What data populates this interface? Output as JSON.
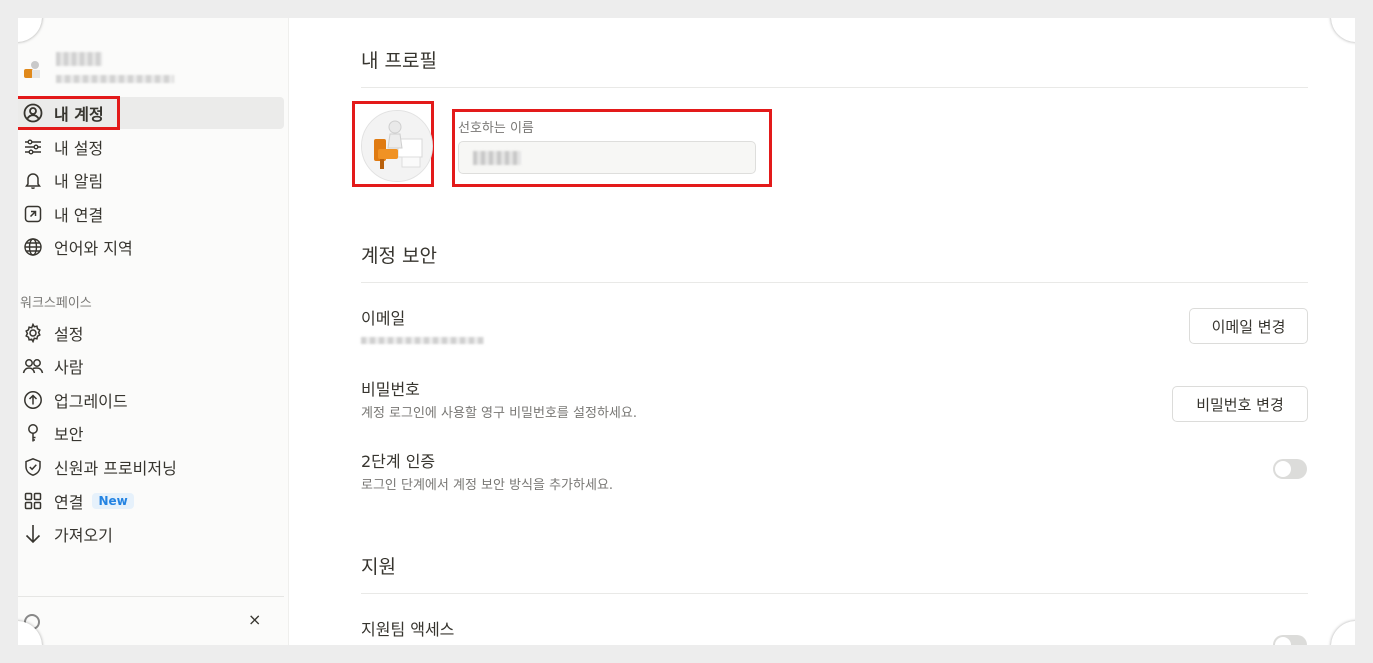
{
  "sidebar": {
    "account_items": [
      {
        "label": "내 계정",
        "icon": "user-circle-icon",
        "active": true
      },
      {
        "label": "내 설정",
        "icon": "sliders-icon"
      },
      {
        "label": "내 알림",
        "icon": "bell-icon"
      },
      {
        "label": "내 연결",
        "icon": "arrow-up-right-box-icon"
      },
      {
        "label": "언어와 지역",
        "icon": "globe-icon"
      }
    ],
    "workspace_label": "워크스페이스",
    "workspace_items": [
      {
        "label": "설정",
        "icon": "gear-icon"
      },
      {
        "label": "사람",
        "icon": "people-icon"
      },
      {
        "label": "업그레이드",
        "icon": "arrow-up-circle-icon"
      },
      {
        "label": "보안",
        "icon": "key-icon"
      },
      {
        "label": "신원과 프로비저닝",
        "icon": "shield-check-icon"
      },
      {
        "label": "연결",
        "icon": "grid-icon",
        "badge": "New"
      },
      {
        "label": "가져오기",
        "icon": "arrow-down-icon"
      }
    ],
    "close_symbol": "×"
  },
  "profile": {
    "title": "내 프로필",
    "preferred_name_label": "선호하는 이름"
  },
  "security": {
    "title": "계정 보안",
    "email_label": "이메일",
    "email_button": "이메일 변경",
    "password_label": "비밀번호",
    "password_desc": "계정 로그인에 사용할 영구 비밀번호를 설정하세요.",
    "password_button": "비밀번호 변경",
    "twofa_label": "2단계 인증",
    "twofa_desc": "로그인 단계에서 계정 보안 방식을 추가하세요.",
    "twofa_enabled": false
  },
  "support": {
    "title": "지원",
    "access_label": "지원팀 액세스",
    "access_enabled": false
  },
  "colors": {
    "highlight": "#e31a1a",
    "badge": "#2383e2"
  }
}
